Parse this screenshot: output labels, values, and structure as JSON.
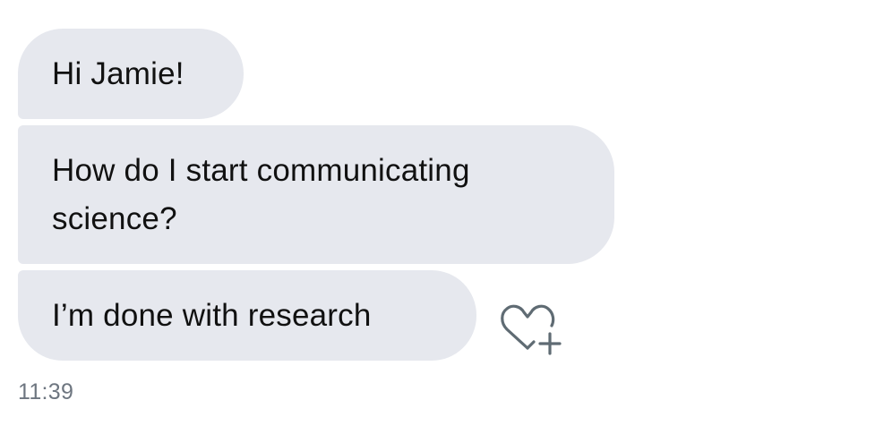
{
  "conversation": {
    "messages": [
      {
        "text": "Hi Jamie!"
      },
      {
        "text": "How do I start communicating science?"
      },
      {
        "text": "I’m done with research"
      }
    ],
    "timestamp": "11:39"
  },
  "actions": {
    "like_icon": "heart-plus-icon"
  },
  "colors": {
    "bubble_background": "#e6e8ee",
    "message_text": "#111111",
    "timestamp_text": "#6e7680",
    "icon_stroke": "#5f6b73"
  }
}
